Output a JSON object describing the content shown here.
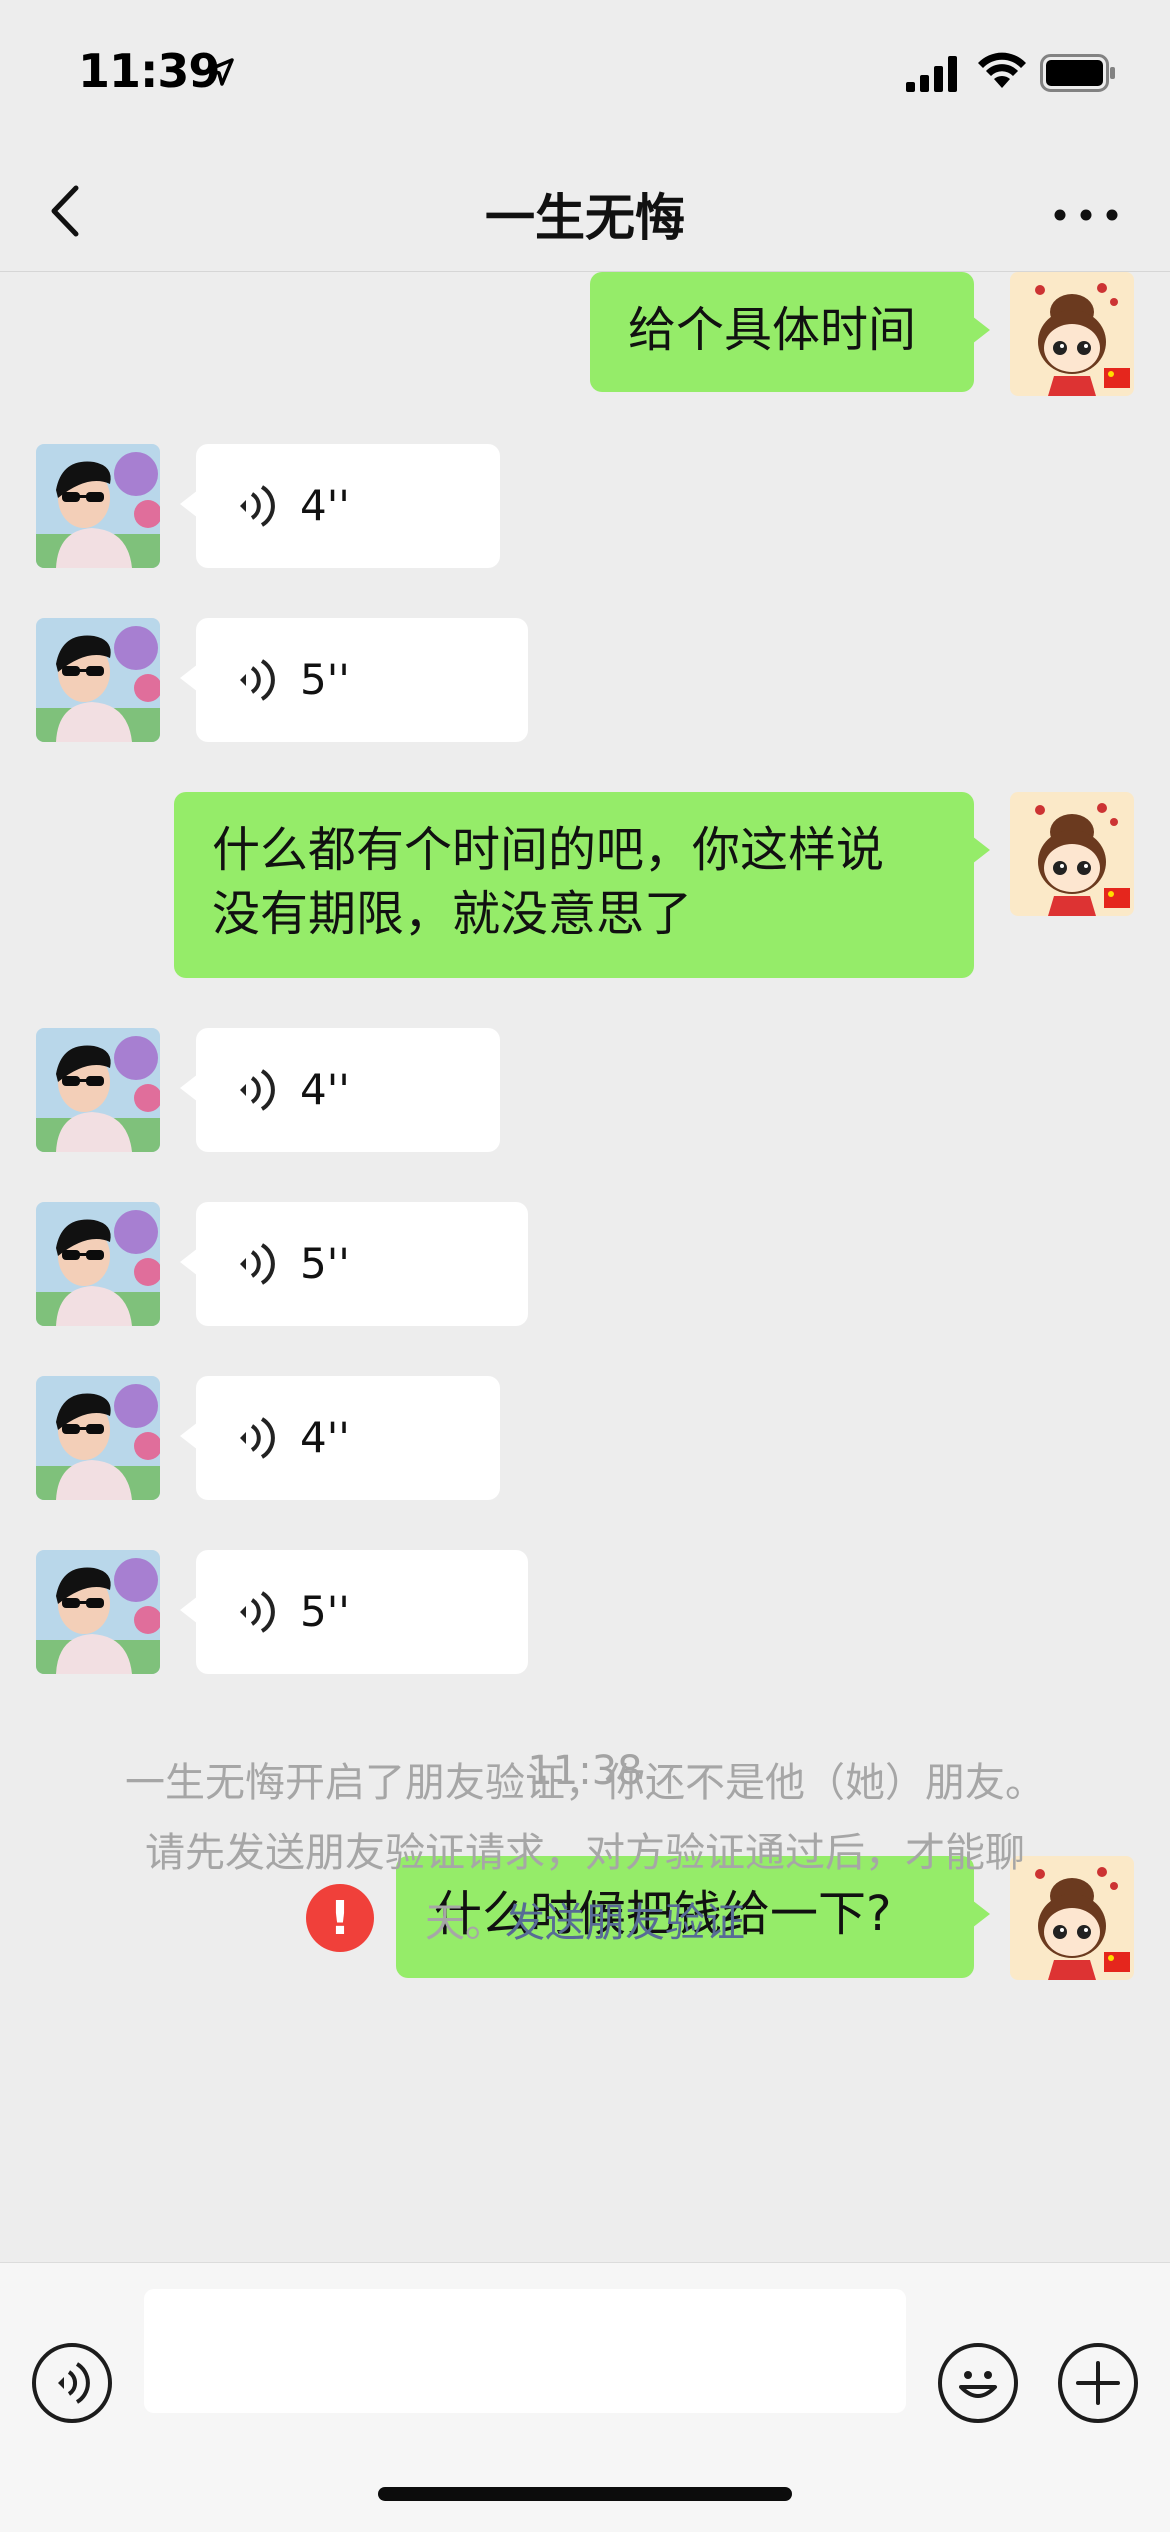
{
  "status_bar": {
    "time": "11:39"
  },
  "nav": {
    "title": "一生无悔"
  },
  "messages": {
    "m1": {
      "text": "给个具体时间"
    },
    "m2": {
      "duration": "4''"
    },
    "m3": {
      "duration": "5''"
    },
    "m4": {
      "line1": "什么都有个时间的吧，你这样说",
      "line2": "没有期限，就没意思了"
    },
    "m5": {
      "duration": "4''"
    },
    "m6": {
      "duration": "5''"
    },
    "m7": {
      "duration": "4''"
    },
    "m8": {
      "duration": "5''"
    },
    "timestamp": "11:38",
    "m9": {
      "text": "什么时候把钱给一下?"
    }
  },
  "error_icon": "!",
  "system_notice": {
    "line1": "一生无悔开启了朋友验证，你还不是他（她）朋友。",
    "line2": "请先发送朋友验证请求，对方验证通过后，才能聊",
    "line3_prefix": "天。",
    "link": "发送朋友验证"
  },
  "input": {
    "placeholder": "",
    "value": ""
  },
  "colors": {
    "green_bubble": "#95ec69",
    "white_bubble": "#ffffff",
    "background": "#ededed",
    "error": "#f0403a",
    "link": "#576b95"
  }
}
